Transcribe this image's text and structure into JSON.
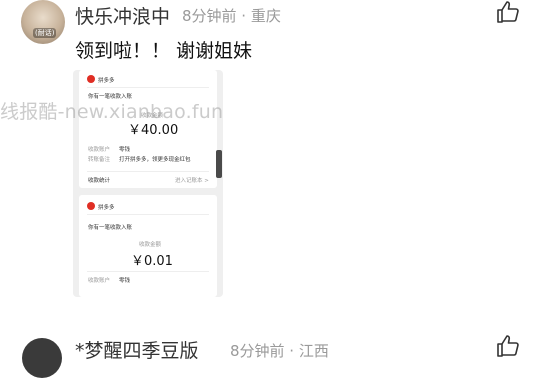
{
  "comment1": {
    "username": "快乐冲浪中",
    "meta": "8分钟前 · 重庆",
    "avatar_tag": "(耐话)",
    "text": "领到啦！！ 谢谢姐妹"
  },
  "watermark": "线报酷-new.xianbao.fun",
  "screenshot": {
    "card1": {
      "app": "拼多多",
      "title": "你有一笔收款入账",
      "amount_label": "收款金额",
      "amount": "￥40.00",
      "account_label": "收款账户",
      "account_value": "零钱",
      "remark_label": "转账备注",
      "remark_value": "打开拼多多，领更多现金红包",
      "stats_label": "收款统计",
      "stats_link": "进入记账本 >"
    },
    "card2": {
      "app": "拼多多",
      "title": "你有一笔收款入账",
      "amount_label": "收款金额",
      "amount": "￥0.01",
      "account_label": "收款账户",
      "account_value": "零钱"
    }
  },
  "comment2": {
    "username": "*梦醒四季豆版",
    "meta": "8分钟前 · 江西"
  },
  "icons": {
    "like": "thumbs-up-icon"
  }
}
